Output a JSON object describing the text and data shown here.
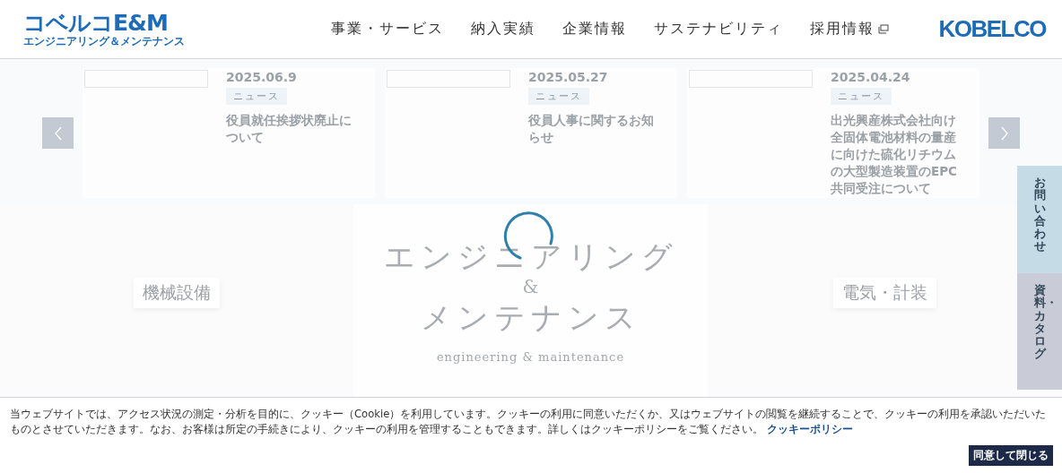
{
  "header": {
    "logo": {
      "main": "コベルコE&M",
      "sub": "エンジニアリング＆メンテナンス"
    },
    "nav": [
      {
        "label": "事業・サービス",
        "external": false
      },
      {
        "label": "納入実績",
        "external": false
      },
      {
        "label": "企業情報",
        "external": false
      },
      {
        "label": "サステナビリティ",
        "external": false
      },
      {
        "label": "採用情報",
        "external": true
      }
    ],
    "brand": "KOBELCO"
  },
  "news": {
    "items": [
      {
        "date": "2025.06.9",
        "category": "ニュース",
        "title": "役員就任挨拶状廃止について"
      },
      {
        "date": "2025.05.27",
        "category": "ニュース",
        "title": "役員人事に関するお知らせ"
      },
      {
        "date": "2025.04.24",
        "category": "ニュース",
        "title": "出光興産株式会社向け全固体電池材料の量産に向けた硫化リチウムの大型製造装置のEPC共同受注について"
      }
    ]
  },
  "hero": {
    "panels": [
      {
        "kind": "category",
        "label": "機械設備"
      },
      {
        "kind": "title",
        "lines": [
          "エンジニアリング",
          "&",
          "メンテナンス"
        ],
        "subtitle": "engineering & maintenance"
      },
      {
        "kind": "category",
        "label": "電気・計装"
      }
    ]
  },
  "side_tabs": [
    {
      "label": "お問い合わせ",
      "color": "#c5dbe6"
    },
    {
      "label": "資料・カタログ",
      "color": "#c9ccd6"
    }
  ],
  "cookie": {
    "text": "当ウェブサイトでは、アクセス状況の測定・分析を目的に、クッキー（Cookie）を利用しています。クッキーの利用に同意いただくか、又はウェブサイトの閲覧を継続することで、クッキーの利用を承認いただいたものとさせていただきます。なお、お客様は所定の手続きにより、クッキーの利用を管理することもできます。詳しくはクッキーポリシーをご覧ください。",
    "link": "クッキーポリシー",
    "button": "同意して閉じる"
  }
}
